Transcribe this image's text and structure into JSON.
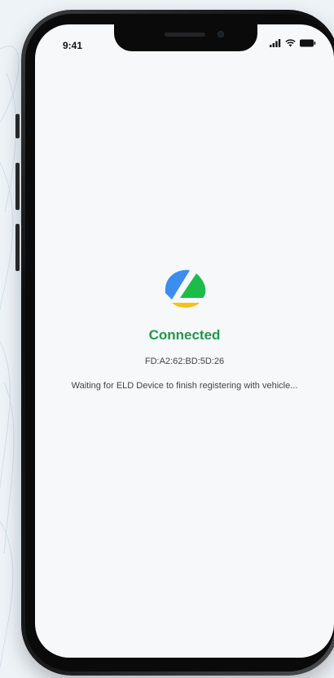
{
  "status_bar": {
    "time": "9:41",
    "icons": [
      "signal-icon",
      "wifi-icon",
      "battery-icon"
    ]
  },
  "app": {
    "logo": "app-logo",
    "status_title": "Connected",
    "device_id": "FD:A2:62:BD:5D:26",
    "message": "Waiting for ELD Device to finish registering with vehicle..."
  },
  "colors": {
    "accent_green": "#1f9a4a",
    "logo_blue": "#3b8df0",
    "logo_green": "#1fbb4a",
    "logo_yellow": "#f2c21a",
    "screen_bg": "#f6f8fa"
  }
}
